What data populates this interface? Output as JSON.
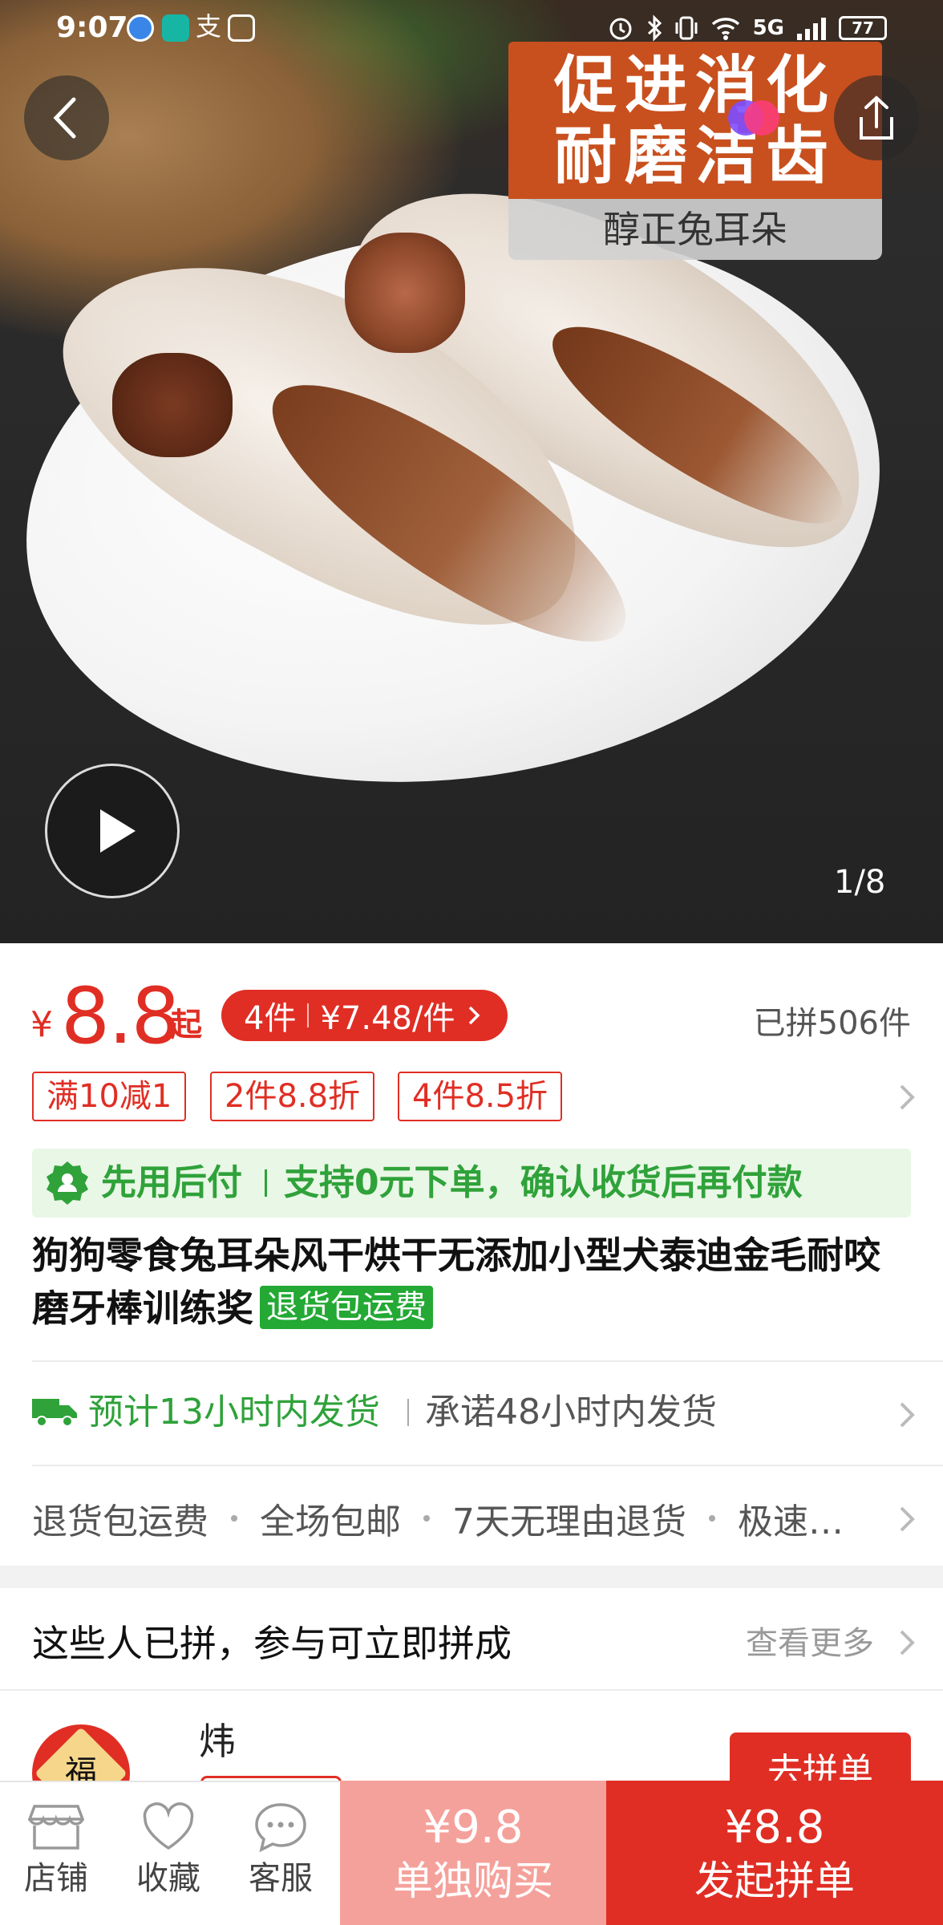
{
  "status_bar": {
    "time": "9:07",
    "network": "5G",
    "battery": "77"
  },
  "hero": {
    "badge_line1": "促进消化",
    "badge_line2": "耐磨洁齿",
    "badge_sub": "醇正兔耳朵",
    "image_counter": "1/8"
  },
  "price": {
    "currency": "¥",
    "value": "8.8",
    "suffix": "起",
    "multi_qty": "4件",
    "multi_price": "¥7.48/件",
    "sold": "已拼506件"
  },
  "coupons": [
    "满10减1",
    "2件8.8折",
    "4件8.5折"
  ],
  "pay_later": {
    "title": "先用后付",
    "desc": "支持0元下单，确认收货后再付款"
  },
  "product": {
    "title": "狗狗零食兔耳朵风干烘干无添加小型犬泰迪金毛耐咬磨牙棒训练奖",
    "tag": "退货包运费"
  },
  "shipping": {
    "estimate": "预计13小时内发货",
    "promise": "承诺48小时内发货"
  },
  "guarantees": [
    "退货包运费",
    "全场包邮",
    "7天无理由退货",
    "极速…"
  ],
  "group": {
    "title": "这些人已拼，参与可立即拼成",
    "more": "查看更多",
    "member_name": "炜",
    "avatar_char": "福",
    "join_label": "去拼单"
  },
  "bottom_bar": {
    "store": "店铺",
    "favorite": "收藏",
    "service": "客服",
    "buy_alone_price": "¥9.8",
    "buy_alone_label": "单独购买",
    "start_group_price": "¥8.8",
    "start_group_label": "发起拼单"
  },
  "colors": {
    "accent_red": "#e02e24",
    "green": "#2fa23a",
    "light_red": "#f5a19b"
  }
}
